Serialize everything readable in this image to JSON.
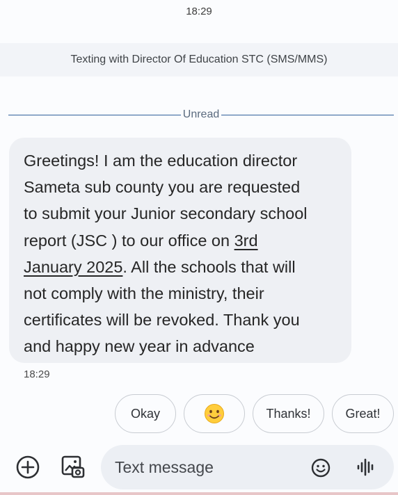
{
  "status_time": "18:29",
  "conversation": {
    "banner": "Texting with Director Of Education STC (SMS/MMS)",
    "unread_label": "Unread"
  },
  "message": {
    "line1": "Greetings! I am the education director",
    "line2": "Sameta sub county  you are requested",
    "line3": "to submit your Junior secondary school",
    "line4a": "report (JSC ) to our office on ",
    "date_part1": "3rd",
    "date_part2": "January 2025",
    "line5b": ". All the schools that will",
    "line6": "not comply with the ministry, their",
    "line7": "certificates will be revoked. Thank you",
    "line8": "and happy new year in advance",
    "time": "18:29"
  },
  "smart_replies": {
    "okay": "Okay",
    "emoji_icon": "smiling-face-emoji",
    "emoji": "😊",
    "thanks": "Thanks!",
    "great": "Great!"
  },
  "composer": {
    "placeholder": "Text message",
    "icons": [
      "add-icon",
      "gallery-icon",
      "emoji-icon",
      "voice-icon"
    ]
  },
  "colors": {
    "bubble": "#eef0f4",
    "unread_line": "#2f5f9a",
    "composer_bg": "#eceff4"
  }
}
